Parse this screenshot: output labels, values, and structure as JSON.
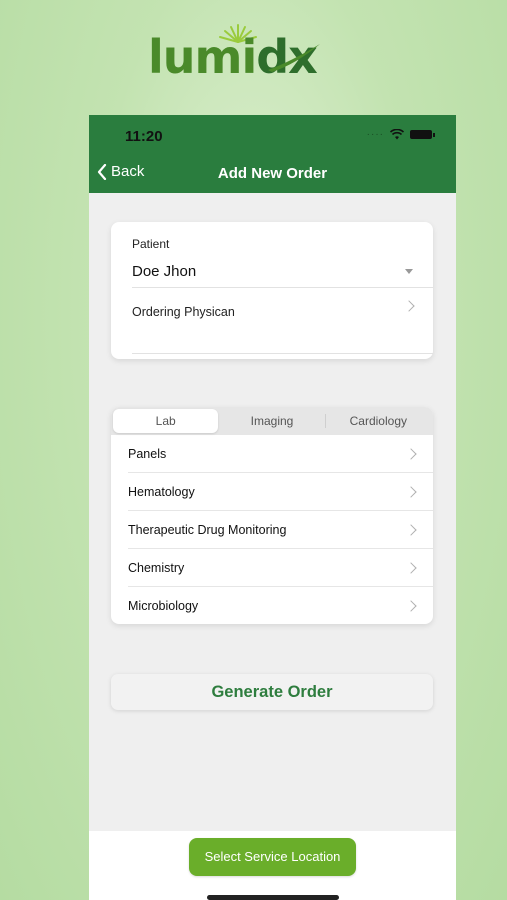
{
  "brand": {
    "logo_text_main": "lumi",
    "logo_text_accent": "dx",
    "logo_icon": "sunburst-icon"
  },
  "status_bar": {
    "time": "11:20",
    "signal_icon": "signal-dots-icon",
    "wifi_icon": "wifi-icon",
    "battery_icon": "battery-icon"
  },
  "nav": {
    "back_label": "Back",
    "title": "Add New Order"
  },
  "patient_card": {
    "patient_label": "Patient",
    "patient_value": "Doe Jhon",
    "physician_label": "Ordering Physican"
  },
  "tabs": [
    {
      "label": "Lab",
      "active": true
    },
    {
      "label": "Imaging",
      "active": false
    },
    {
      "label": "Cardiology",
      "active": false
    }
  ],
  "categories": [
    {
      "label": "Panels"
    },
    {
      "label": "Hematology"
    },
    {
      "label": "Therapeutic Drug Monitoring"
    },
    {
      "label": "Chemistry"
    },
    {
      "label": "Microbiology"
    }
  ],
  "actions": {
    "generate_label": "Generate Order",
    "service_location_label": "Select Service Location"
  },
  "colors": {
    "primary_green": "#2a7d3e",
    "accent_green": "#6aae2a",
    "background": "#c3e3b1"
  }
}
